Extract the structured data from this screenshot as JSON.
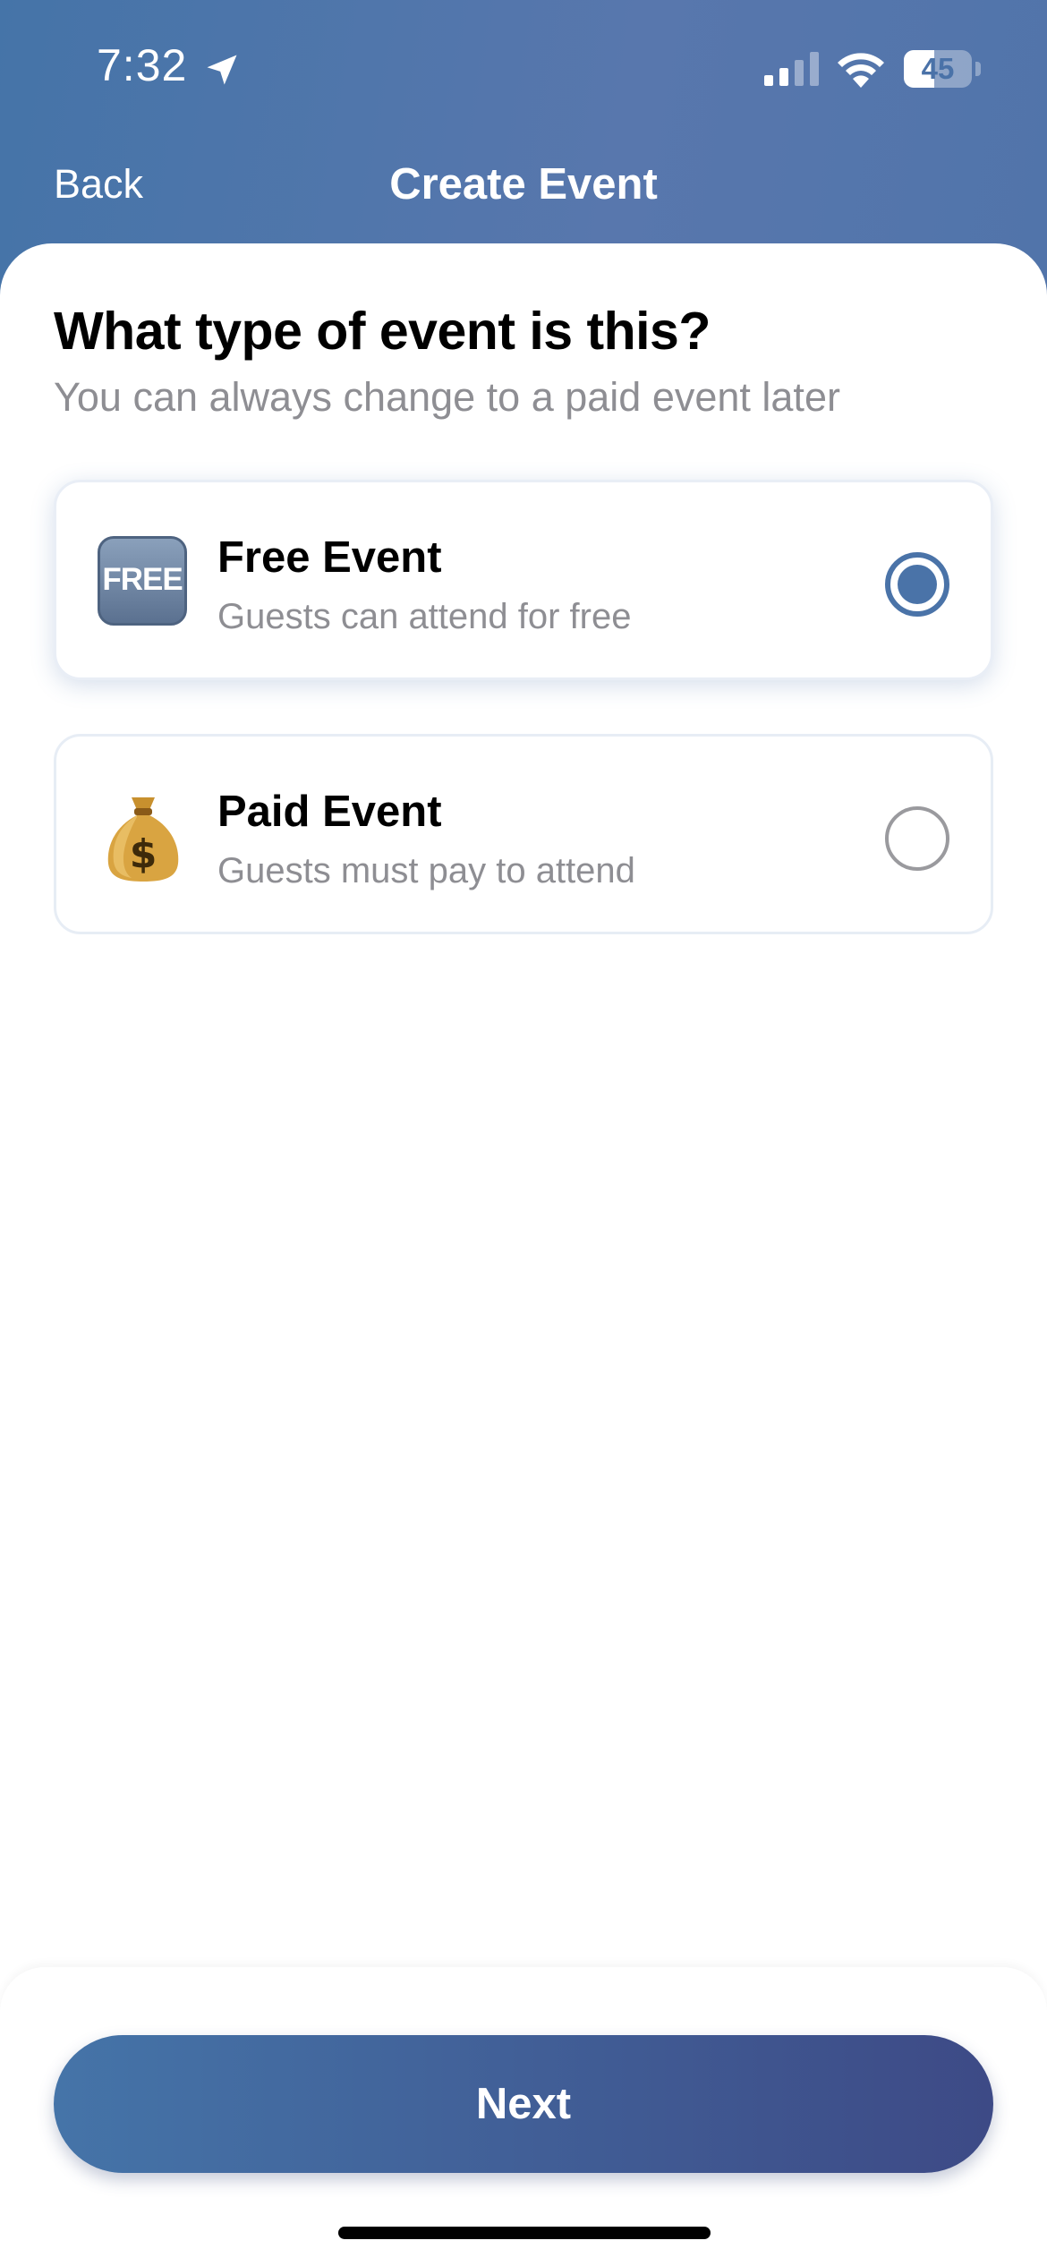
{
  "status_bar": {
    "time": "7:32",
    "battery_level": "45",
    "icons": [
      "location-arrow-icon",
      "signal-icon",
      "wifi-icon",
      "battery-icon"
    ]
  },
  "nav": {
    "back_label": "Back",
    "title": "Create Event"
  },
  "content": {
    "question": "What type of event is this?",
    "subtitle": "You can always change to a paid event later"
  },
  "options": [
    {
      "icon": "free-icon",
      "icon_text": "FREE",
      "title": "Free Event",
      "description": "Guests can attend for free",
      "selected": true
    },
    {
      "icon": "money-bag-icon",
      "title": "Paid Event",
      "description": "Guests must pay to attend",
      "selected": false
    }
  ],
  "footer": {
    "next_label": "Next"
  },
  "colors": {
    "header_bg": "#4a73a8",
    "accent": "#4a73a8",
    "button_gradient_end": "#3d4a86",
    "muted_text": "#8e8e93"
  }
}
